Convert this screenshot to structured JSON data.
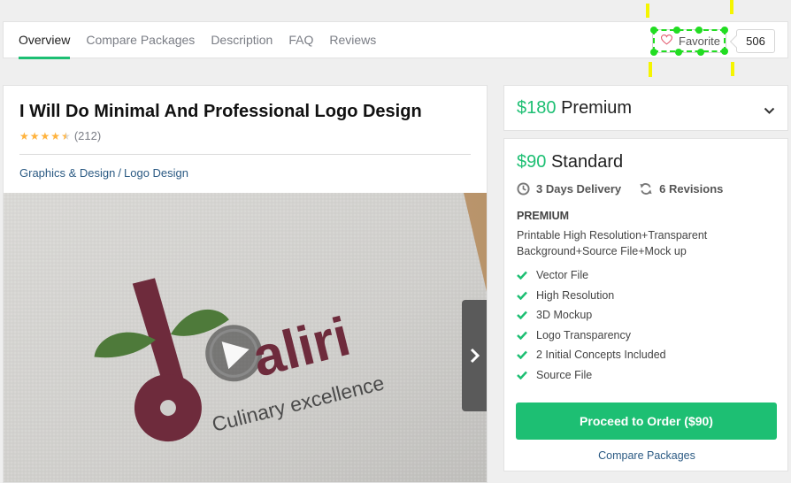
{
  "nav": {
    "tabs": [
      {
        "label": "Overview",
        "active": true
      },
      {
        "label": "Compare Packages",
        "active": false
      },
      {
        "label": "Description",
        "active": false
      },
      {
        "label": "FAQ",
        "active": false
      },
      {
        "label": "Reviews",
        "active": false
      }
    ],
    "favorite_label": "Favorite",
    "favorite_count": "506"
  },
  "gig": {
    "title": "I Will Do Minimal And Professional Logo Design",
    "rating_stars": 4.5,
    "rating_count": "(212)",
    "breadcrumb": [
      "Graphics & Design",
      "Logo Design"
    ],
    "breadcrumb_sep": "/",
    "media": {
      "brand_word": "aliri",
      "tagline": "Culinary excellence"
    }
  },
  "packages": {
    "premium": {
      "price": "$180",
      "name": "Premium"
    },
    "standard": {
      "price": "$90",
      "name": "Standard",
      "delivery": "3 Days Delivery",
      "revisions": "6 Revisions",
      "tier_label": "PREMIUM",
      "description": "Printable High Resolution+Transparent Background+Source File+Mock up",
      "features": [
        "Vector File",
        "High Resolution",
        "3D Mockup",
        "Logo Transparency",
        "2 Initial Concepts Included",
        "Source File"
      ],
      "order_button": "Proceed to Order ($90)",
      "compare_link": "Compare Packages"
    }
  },
  "colors": {
    "accent_green": "#1dbf73",
    "link_blue": "#2b5a83",
    "star": "#ffb33e",
    "annotation_yellow": "#f5f500",
    "annotation_green": "#22dd22"
  }
}
